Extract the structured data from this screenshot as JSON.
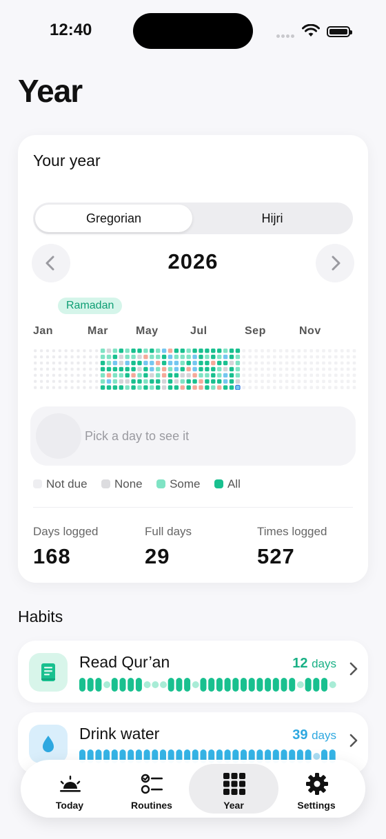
{
  "status_bar": {
    "time": "12:40"
  },
  "page_title": "Year",
  "year_card": {
    "title": "Your year",
    "segments": [
      "Gregorian",
      "Hijri"
    ],
    "selected_segment": "Gregorian",
    "year": "2026",
    "prev_icon": "chevron-left-icon",
    "next_icon": "chevron-right-icon",
    "ramadan_label": "Ramadan",
    "months": [
      "Jan",
      "Mar",
      "May",
      "Jul",
      "Sep",
      "Nov"
    ],
    "day_hint": "Pick a day to see it",
    "legend": [
      {
        "label": "Not due",
        "color": "#eeeef1"
      },
      {
        "label": "None",
        "color": "#dcdcdf"
      },
      {
        "label": "Some",
        "color": "#7fe3c4"
      },
      {
        "label": "All",
        "color": "#19c08f"
      }
    ],
    "stats": [
      {
        "label": "Days logged",
        "value": "168"
      },
      {
        "label": "Full days",
        "value": "29"
      },
      {
        "label": "Times logged",
        "value": "527"
      }
    ]
  },
  "habits_title": "Habits",
  "habits": [
    {
      "name": "Read Qur’an",
      "count": "12",
      "unit": "days",
      "color": "#19c08f",
      "icon": "book-icon"
    },
    {
      "name": "Drink water",
      "count": "39",
      "unit": "days",
      "color": "#35b4e6",
      "icon": "water-drop-icon"
    }
  ],
  "tabbar": [
    {
      "label": "Today",
      "icon": "sunrise-icon"
    },
    {
      "label": "Routines",
      "icon": "checklist-icon"
    },
    {
      "label": "Year",
      "icon": "grid-icon"
    },
    {
      "label": "Settings",
      "icon": "gear-icon"
    }
  ],
  "active_tab": "Year"
}
